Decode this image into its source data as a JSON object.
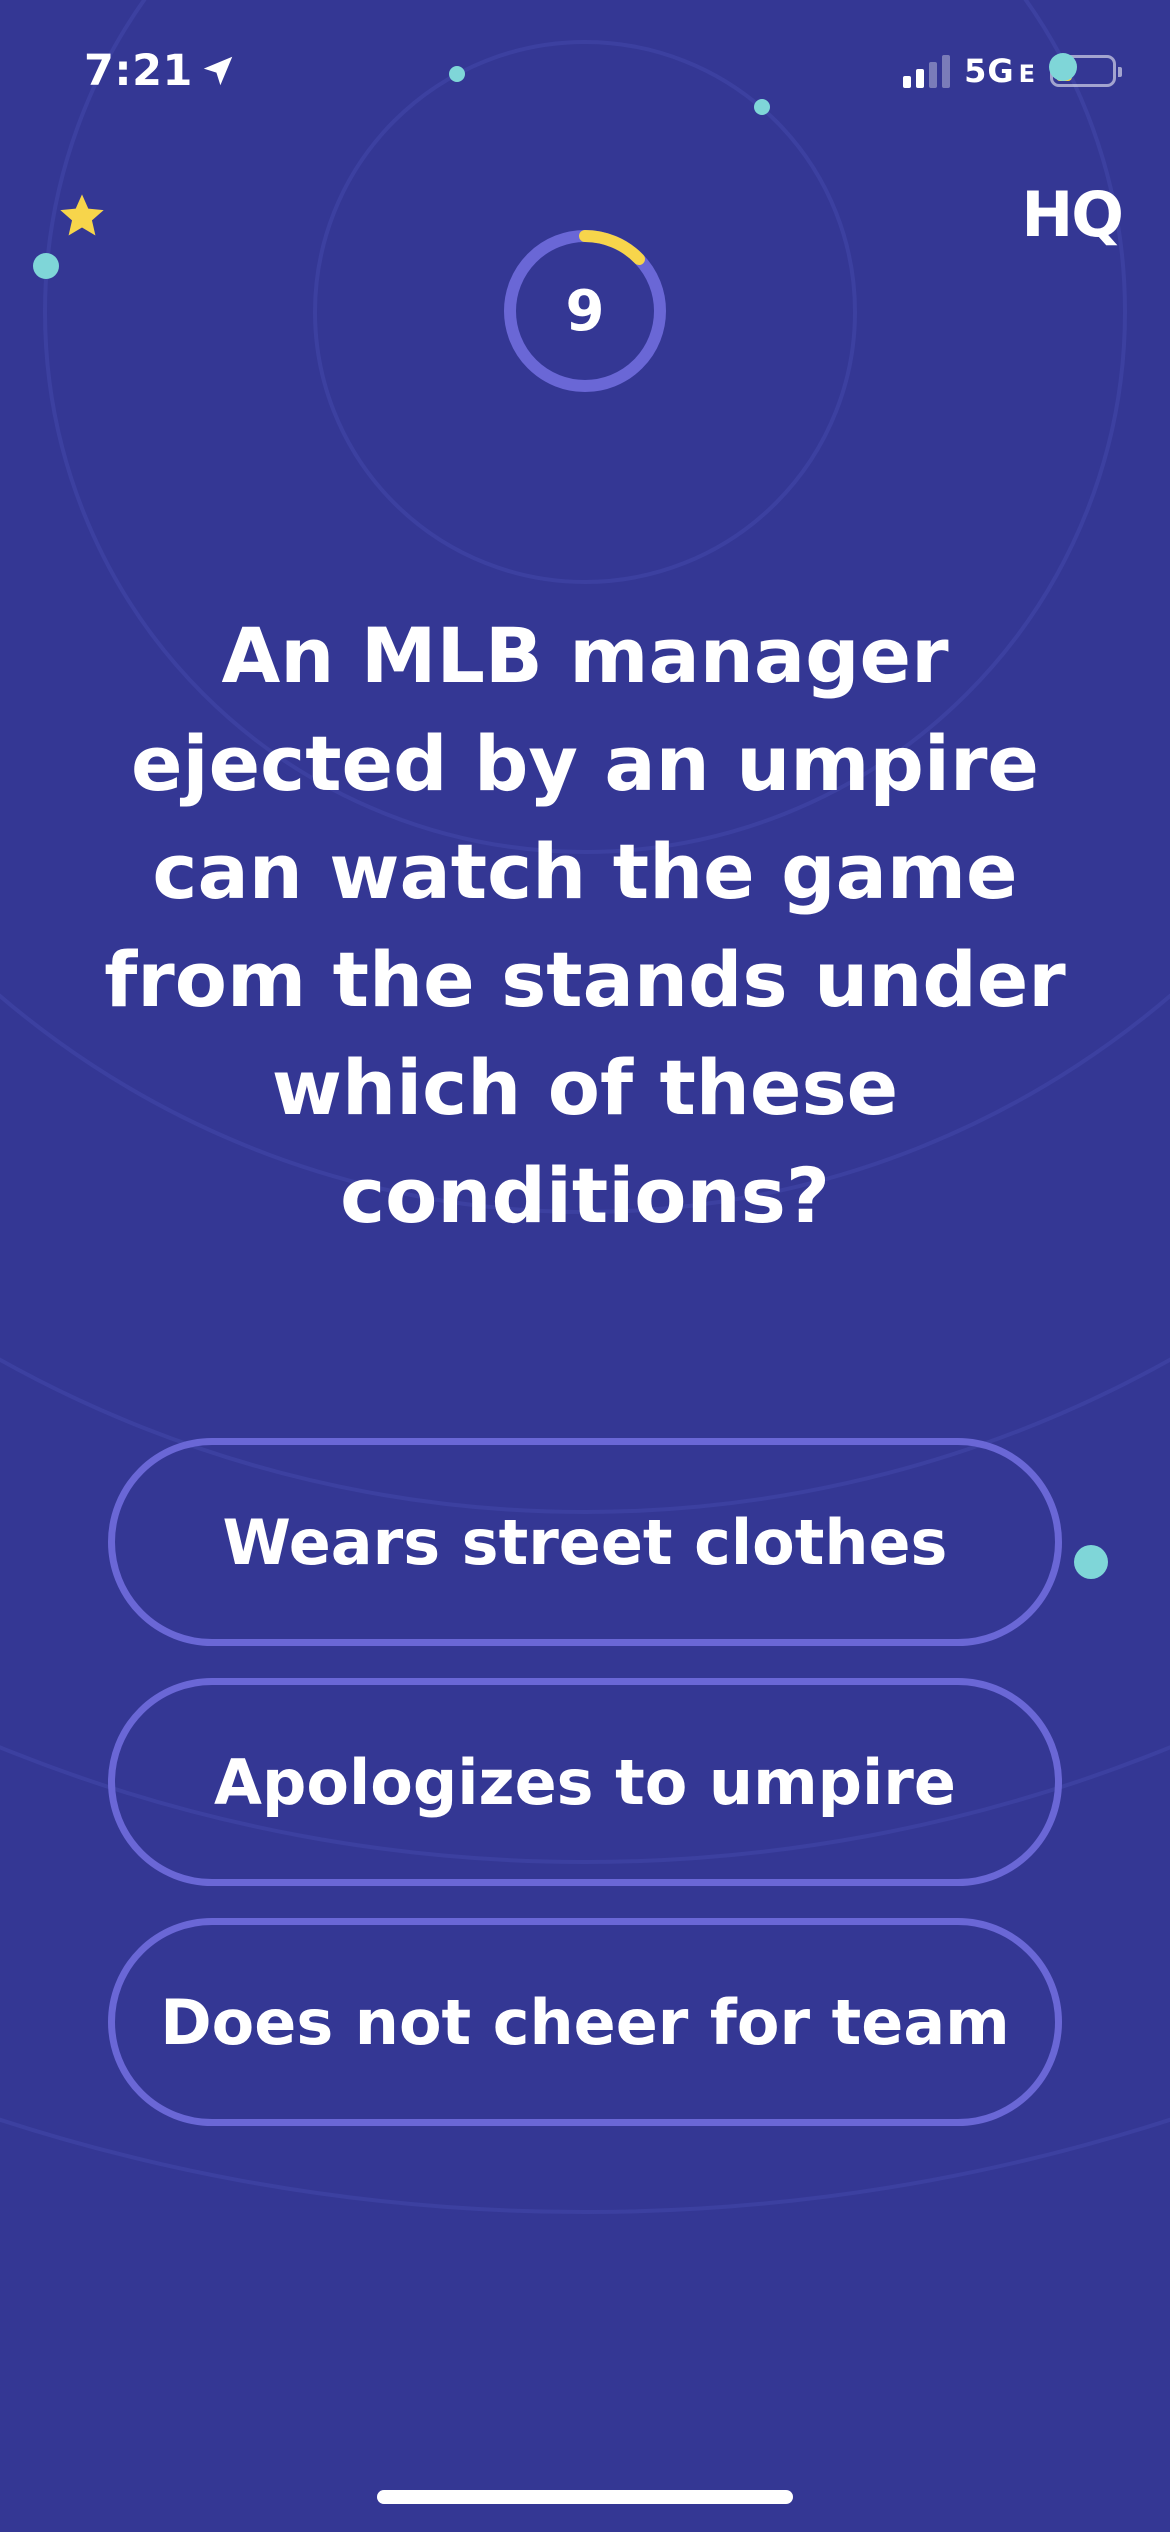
{
  "status_bar": {
    "time": "7:21",
    "network": "5G",
    "network_suffix": "E"
  },
  "logo": {
    "text": "HQ"
  },
  "timer": {
    "count": "9"
  },
  "question": {
    "text": "An MLB manager ejected by an umpire can watch the game from the stands under which of these conditions?"
  },
  "answers": [
    {
      "label": "Wears street clothes"
    },
    {
      "label": "Apologizes to umpire"
    },
    {
      "label": "Does not cheer for team"
    }
  ],
  "colors": {
    "background": "#343794",
    "ring": "#6a67d6",
    "accent": "#f7d54b",
    "dot": "#7fd6d8"
  }
}
